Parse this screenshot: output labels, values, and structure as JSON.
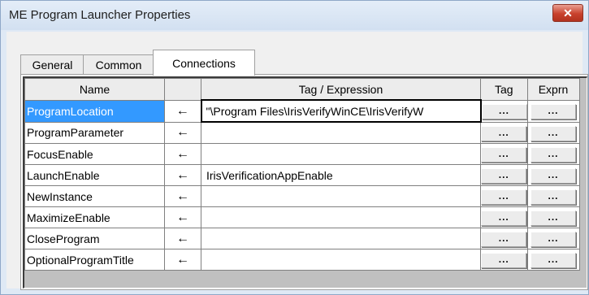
{
  "window": {
    "title": "ME Program Launcher Properties",
    "close_icon": "close-icon"
  },
  "tabs": [
    {
      "label": "General",
      "active": false
    },
    {
      "label": "Common",
      "active": false
    },
    {
      "label": "Connections",
      "active": true
    }
  ],
  "grid": {
    "columns": {
      "name": "Name",
      "arrow": "",
      "tag_expression": "Tag / Expression",
      "tag": "Tag",
      "exprn": "Exprn"
    },
    "rows": [
      {
        "name": "ProgramLocation",
        "arrow": "←",
        "value": "\"\\Program Files\\IrisVerifyWinCE\\IrisVerifyW",
        "tag_btn": "...",
        "exprn_btn": "...",
        "selected": true
      },
      {
        "name": "ProgramParameter",
        "arrow": "←",
        "value": "",
        "tag_btn": "...",
        "exprn_btn": "..."
      },
      {
        "name": "FocusEnable",
        "arrow": "←",
        "value": "",
        "tag_btn": "...",
        "exprn_btn": "..."
      },
      {
        "name": "LaunchEnable",
        "arrow": "←",
        "value": "IrisVerificationAppEnable",
        "tag_btn": "...",
        "exprn_btn": "..."
      },
      {
        "name": "NewInstance",
        "arrow": "←",
        "value": "",
        "tag_btn": "...",
        "exprn_btn": "..."
      },
      {
        "name": "MaximizeEnable",
        "arrow": "←",
        "value": "",
        "tag_btn": "...",
        "exprn_btn": "..."
      },
      {
        "name": "CloseProgram",
        "arrow": "←",
        "value": "",
        "tag_btn": "...",
        "exprn_btn": "..."
      },
      {
        "name": "OptionalProgramTitle",
        "arrow": "←",
        "value": "",
        "tag_btn": "...",
        "exprn_btn": "..."
      }
    ]
  },
  "colors": {
    "selection": "#3399ff",
    "titlebar": "#dfe9f5",
    "close": "#c8412c"
  }
}
